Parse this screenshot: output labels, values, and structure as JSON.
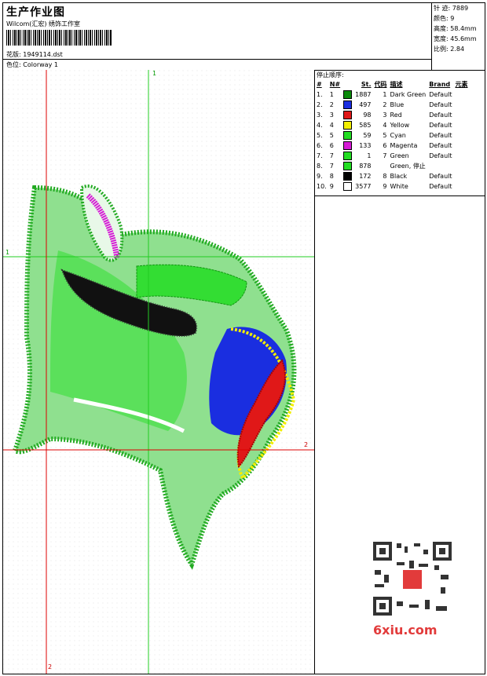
{
  "header": {
    "title": "生产作业图",
    "subtitle": "Wilcom(汇宏) 绣饰工作室",
    "design_label": "花版:",
    "design_value": "1949114.dst",
    "colorway_label": "色位:",
    "colorway_value": "Colorway 1"
  },
  "stats": {
    "stitches": "针 迹: 7889",
    "colors": "颜色: 9",
    "height": "高度: 58.4mm",
    "width": "宽度: 45.6mm",
    "scale": "比例: 2.84"
  },
  "sequence": {
    "heading": "停止顺序:",
    "columns": [
      "#",
      "N#",
      "St.",
      "代码",
      "描述",
      "Brand",
      "元素"
    ],
    "rows": [
      {
        "num": "1.",
        "n": "1",
        "color": "#0a8a0a",
        "st": "1887",
        "code": "1",
        "desc": "Dark Green",
        "brand": "Default"
      },
      {
        "num": "2.",
        "n": "2",
        "color": "#1a2ee0",
        "st": "497",
        "code": "2",
        "desc": "Blue",
        "brand": "Default"
      },
      {
        "num": "3.",
        "n": "3",
        "color": "#e01818",
        "st": "98",
        "code": "3",
        "desc": "Red",
        "brand": "Default"
      },
      {
        "num": "4.",
        "n": "4",
        "color": "#f2ee00",
        "st": "585",
        "code": "4",
        "desc": "Yellow",
        "brand": "Default"
      },
      {
        "num": "5.",
        "n": "5",
        "color": "#22dd22",
        "st": "59",
        "code": "5",
        "desc": "Cyan",
        "brand": "Default"
      },
      {
        "num": "6.",
        "n": "6",
        "color": "#d61ad6",
        "st": "133",
        "code": "6",
        "desc": "Magenta",
        "brand": "Default"
      },
      {
        "num": "7.",
        "n": "7",
        "color": "#22dd22",
        "st": "1",
        "code": "7",
        "desc": "Green",
        "brand": "Default"
      },
      {
        "num": "8.",
        "n": "7",
        "color": "#22dd22",
        "st": "878",
        "code": "",
        "desc": "Green, 停止",
        "brand": ""
      },
      {
        "num": "9.",
        "n": "8",
        "color": "#000000",
        "st": "172",
        "code": "8",
        "desc": "Black",
        "brand": "Default"
      },
      {
        "num": "10.",
        "n": "9",
        "color": "#ffffff",
        "st": "3577",
        "code": "9",
        "desc": "White",
        "brand": "Default"
      }
    ]
  },
  "axes": {
    "green_top": "1",
    "green_left": "1",
    "red_right": "2",
    "red_bottom": "2"
  },
  "watermark": "6xiu.com",
  "colors": {
    "green_axis": "#22cc22",
    "red_axis": "#dd0000"
  }
}
